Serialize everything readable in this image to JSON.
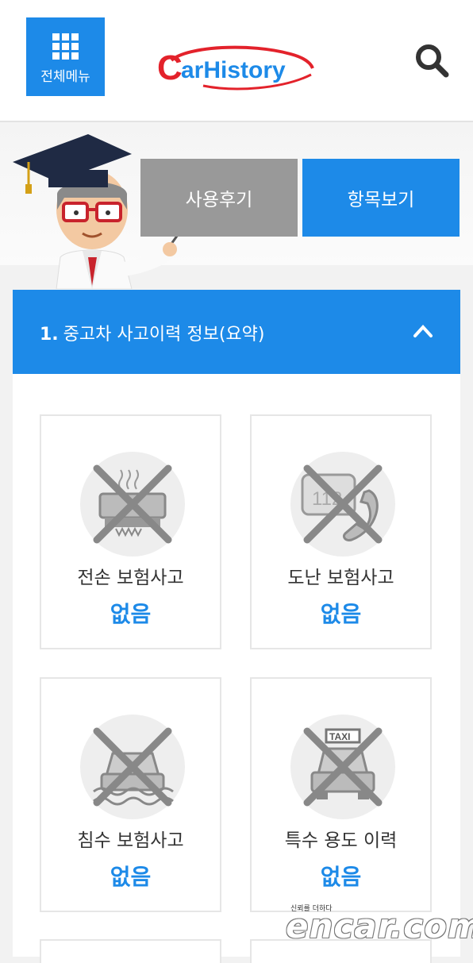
{
  "header": {
    "menu_label": "전체메뉴",
    "logo_text": "CarHistory"
  },
  "hero": {
    "review_button": "사용후기",
    "items_button": "항목보기"
  },
  "section": {
    "number": "1.",
    "title": "중고차 사고이력 정보(요약)"
  },
  "cards": [
    {
      "label": "전손 보험사고",
      "value": "없음",
      "icon": "total-loss-car-icon"
    },
    {
      "label": "도난 보험사고",
      "value": "없음",
      "icon": "theft-phone-icon"
    },
    {
      "label": "침수 보험사고",
      "value": "없음",
      "icon": "flood-car-icon"
    },
    {
      "label": "특수 용도 이력",
      "value": "없음",
      "icon": "taxi-icon"
    }
  ],
  "watermark": {
    "tagline": "신뢰를 더하다",
    "brand": "encar.com"
  },
  "colors": {
    "accent": "#1d8ae8",
    "gray_button": "#999999",
    "logo_red": "#e3222b"
  }
}
